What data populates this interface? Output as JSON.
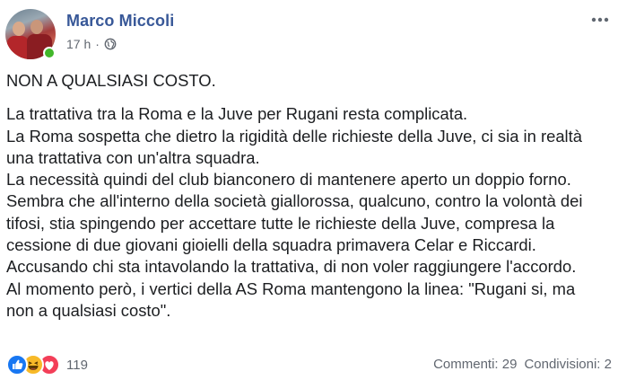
{
  "post": {
    "author": "Marco Miccoli",
    "time": "17 h",
    "separator": "·",
    "privacy_icon": "globe-icon",
    "menu_icon": "more-horizontal-icon",
    "headline": "NON A QUALSIASI COSTO.",
    "lines": [
      "La trattativa tra la Roma e la Juve per Rugani resta complicata.",
      "La Roma sospetta che dietro la rigidità delle richieste della Juve, ci sia in realtà",
      "una trattativa con un'altra squadra.",
      "La necessità quindi del club bianconero di mantenere aperto un doppio forno.",
      "Sembra che all'interno della società giallorossa, qualcuno, contro la volontà dei",
      "tifosi, stia spingendo per accettare tutte le richieste della Juve, compresa la",
      "cessione di due giovani gioielli della squadra primavera Celar e Riccardi.",
      "Accusando chi sta intavolando la trattativa, di non voler raggiungere l'accordo.",
      "Al momento però, i vertici della AS Roma mantengono la linea: \"Rugani si, ma",
      "non a qualsiasi costo\"."
    ]
  },
  "footer": {
    "reactions": [
      "like-icon",
      "haha-icon",
      "love-icon"
    ],
    "reaction_count": "119",
    "comments": "Commenti: 29",
    "shares": "Condivisioni: 2"
  },
  "colors": {
    "author": "#385898",
    "meta": "#616770",
    "online": "#42b72a",
    "like": "#1877f2",
    "haha": "#f7b928",
    "love": "#f33e58"
  }
}
